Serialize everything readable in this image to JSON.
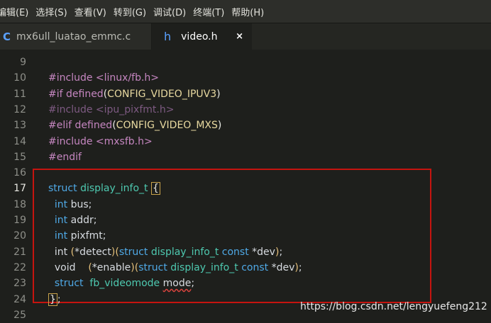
{
  "menubar": [
    "编辑(E)",
    "选择(S)",
    "查看(V)",
    "转到(G)",
    "调试(D)",
    "终端(T)",
    "帮助(H)"
  ],
  "tabs": [
    {
      "icon": "C",
      "label": "mx6ull_luatao_emmc.c"
    },
    {
      "icon": "h",
      "label": "video.h",
      "close": "×"
    }
  ],
  "lines": [
    {
      "n": "9",
      "tokens": []
    },
    {
      "n": "10",
      "tokens": [
        {
          "c": "pp",
          "t": "#include "
        },
        {
          "c": "pp",
          "t": "<linux/fb.h>"
        }
      ]
    },
    {
      "n": "11",
      "tokens": [
        {
          "c": "pp",
          "t": "#if defined"
        },
        {
          "c": "punc",
          "t": "("
        },
        {
          "c": "mac",
          "t": "CONFIG_VIDEO_IPUV3"
        },
        {
          "c": "punc",
          "t": ")"
        }
      ]
    },
    {
      "n": "12",
      "tokens": [
        {
          "c": "dim",
          "t": "#include <ipu_pixfmt.h>"
        }
      ]
    },
    {
      "n": "13",
      "tokens": [
        {
          "c": "pp",
          "t": "#elif defined"
        },
        {
          "c": "punc",
          "t": "("
        },
        {
          "c": "mac",
          "t": "CONFIG_VIDEO_MXS"
        },
        {
          "c": "punc",
          "t": ")"
        }
      ]
    },
    {
      "n": "14",
      "tokens": [
        {
          "c": "pp",
          "t": "#include "
        },
        {
          "c": "pp",
          "t": "<mxsfb.h>"
        }
      ]
    },
    {
      "n": "15",
      "tokens": [
        {
          "c": "pp",
          "t": "#endif"
        }
      ]
    },
    {
      "n": "16",
      "tokens": []
    },
    {
      "n": "17",
      "current": true,
      "tokens": [
        {
          "c": "type",
          "t": "struct "
        },
        {
          "c": "name",
          "t": "display_info_t "
        },
        {
          "c": "cursor",
          "t": "{"
        }
      ]
    },
    {
      "n": "18",
      "tokens": [
        {
          "c": "id",
          "t": "  "
        },
        {
          "c": "type",
          "t": "int "
        },
        {
          "c": "id",
          "t": "bus;"
        }
      ]
    },
    {
      "n": "19",
      "tokens": [
        {
          "c": "id",
          "t": "  "
        },
        {
          "c": "type",
          "t": "int "
        },
        {
          "c": "id",
          "t": "addr;"
        }
      ]
    },
    {
      "n": "20",
      "tokens": [
        {
          "c": "id",
          "t": "  "
        },
        {
          "c": "type",
          "t": "int "
        },
        {
          "c": "id",
          "t": "pixfmt;"
        }
      ]
    },
    {
      "n": "21",
      "tokens": [
        {
          "c": "id",
          "t": "  int "
        },
        {
          "c": "paren",
          "t": "("
        },
        {
          "c": "id",
          "t": "*detect"
        },
        {
          "c": "paren",
          "t": ")("
        },
        {
          "c": "type",
          "t": "struct "
        },
        {
          "c": "name",
          "t": "display_info_t "
        },
        {
          "c": "type",
          "t": "const "
        },
        {
          "c": "id",
          "t": "*dev"
        },
        {
          "c": "paren",
          "t": ")"
        },
        {
          "c": "id",
          "t": ";"
        }
      ]
    },
    {
      "n": "22",
      "tokens": [
        {
          "c": "id",
          "t": "  void    "
        },
        {
          "c": "paren",
          "t": "("
        },
        {
          "c": "id",
          "t": "*enable"
        },
        {
          "c": "paren",
          "t": ")("
        },
        {
          "c": "type",
          "t": "struct "
        },
        {
          "c": "name",
          "t": "display_info_t "
        },
        {
          "c": "type",
          "t": "const "
        },
        {
          "c": "id",
          "t": "*dev"
        },
        {
          "c": "paren",
          "t": ")"
        },
        {
          "c": "id",
          "t": ";"
        }
      ]
    },
    {
      "n": "23",
      "tokens": [
        {
          "c": "id",
          "t": "  "
        },
        {
          "c": "type",
          "t": "struct  "
        },
        {
          "c": "name",
          "t": "fb_videomode "
        },
        {
          "c": "squig",
          "t": "mode"
        },
        {
          "c": "id",
          "t": ";"
        }
      ]
    },
    {
      "n": "24",
      "tokens": [
        {
          "c": "cursor",
          "t": "}"
        },
        {
          "c": "id",
          "t": ";"
        }
      ]
    },
    {
      "n": "25",
      "tokens": []
    }
  ],
  "watermark": "https://blog.csdn.net/lengyuefeng212"
}
